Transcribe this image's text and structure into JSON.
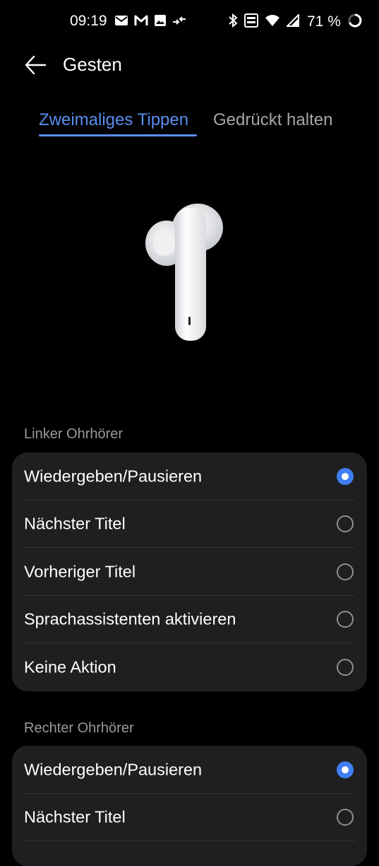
{
  "status_bar": {
    "time": "09:19",
    "left_icons": [
      "mail-icon",
      "gmail-icon",
      "image-icon",
      "transfer-icon"
    ],
    "right_icons": [
      "bluetooth-icon",
      "volte-icon",
      "wifi-icon",
      "signal-icon"
    ],
    "battery_percent": "71 %"
  },
  "header": {
    "title": "Gesten"
  },
  "tabs": [
    {
      "label": "Zweimaliges Tippen",
      "active": true
    },
    {
      "label": "Gedrückt halten",
      "active": false
    }
  ],
  "colors": {
    "accent": "#3f7ff1",
    "tab_active": "#5b8def",
    "card_bg": "#1f1f21",
    "background": "#000000"
  },
  "sections": [
    {
      "label": "Linker Ohrhörer",
      "options": [
        {
          "label": "Wiedergeben/Pausieren",
          "selected": true
        },
        {
          "label": "Nächster Titel",
          "selected": false
        },
        {
          "label": "Vorheriger Titel",
          "selected": false
        },
        {
          "label": "Sprachassistenten aktivieren",
          "selected": false
        },
        {
          "label": "Keine Aktion",
          "selected": false
        }
      ]
    },
    {
      "label": "Rechter Ohrhörer",
      "options": [
        {
          "label": "Wiedergeben/Pausieren",
          "selected": true
        },
        {
          "label": "Nächster Titel",
          "selected": false
        }
      ]
    }
  ]
}
